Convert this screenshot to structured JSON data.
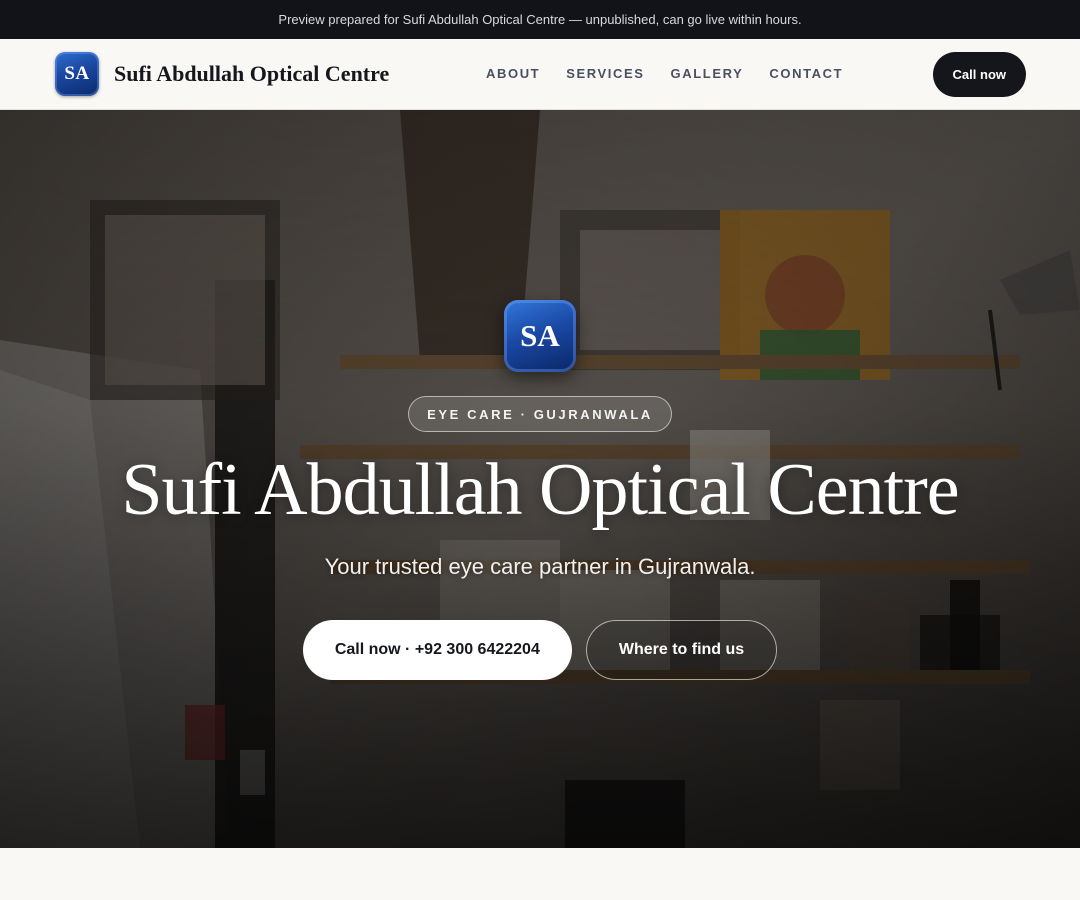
{
  "preview_banner": "Preview prepared for Sufi Abdullah Optical Centre — unpublished, can go live within hours.",
  "header": {
    "logo_initials": "SA",
    "brand_name": "Sufi Abdullah Optical Centre",
    "nav": [
      "ABOUT",
      "SERVICES",
      "GALLERY",
      "CONTACT"
    ],
    "cta_label": "Call now"
  },
  "hero": {
    "logo_initials": "SA",
    "eyebrow": "EYE CARE · GUJRANWALA",
    "title": "Sufi Abdullah Optical Centre",
    "subtitle": "Your trusted eye care partner in Gujranwala.",
    "primary_cta": "Call now · +92 300 6422204",
    "secondary_cta": "Where to find us"
  },
  "colors": {
    "dark": "#111319",
    "logo_blue": "#1a47a0",
    "page_bg": "#f7f6f2"
  }
}
